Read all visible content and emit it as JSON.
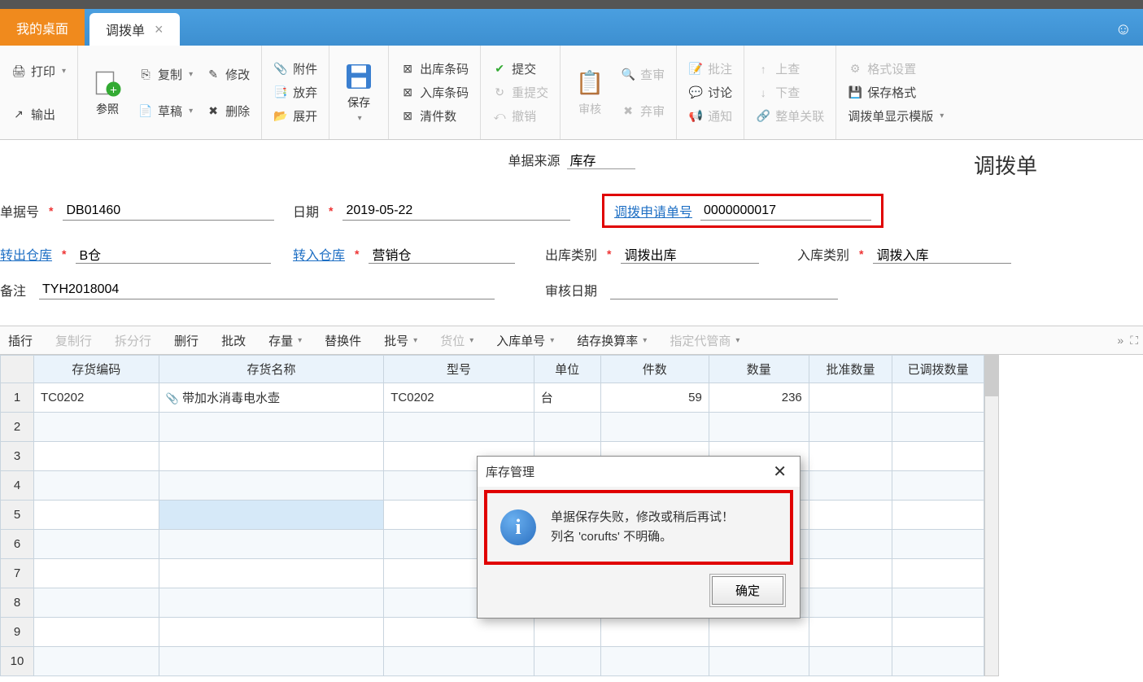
{
  "tabs": {
    "desktop": "我的桌面",
    "active": "调拨单"
  },
  "ribbon": {
    "print": "打印",
    "export": "输出",
    "ref": "参照",
    "copy": "复制",
    "draft": "草稿",
    "modify": "修改",
    "delete": "删除",
    "attach": "附件",
    "discard": "放弃",
    "expand": "展开",
    "save": "保存",
    "out_barcode": "出库条码",
    "in_barcode": "入库条码",
    "clear_count": "清件数",
    "submit": "提交",
    "resubmit": "重提交",
    "revoke": "撤销",
    "audit": "审核",
    "review": "查审",
    "abandon": "弃审",
    "note": "批注",
    "discuss": "讨论",
    "notify": "通知",
    "up": "上查",
    "down": "下查",
    "whole_link": "整单关联",
    "format_set": "格式设置",
    "save_format": "保存格式",
    "display_tpl": "调拨单显示模版"
  },
  "doc": {
    "source_label": "单据来源",
    "source_value": "库存",
    "title": "调拨单",
    "no_label": "单据号",
    "no_value": "DB01460",
    "date_label": "日期",
    "date_value": "2019-05-22",
    "req_no_label": "调拨申请单号",
    "req_no_value": "0000000017",
    "out_wh_label": "转出仓库",
    "out_wh_value": "B仓",
    "in_wh_label": "转入仓库",
    "in_wh_value": "营销仓",
    "out_type_label": "出库类别",
    "out_type_value": "调拨出库",
    "in_type_label": "入库类别",
    "in_type_value": "调拨入库",
    "remark_label": "备注",
    "remark_value": "TYH2018004",
    "audit_date_label": "审核日期",
    "audit_date_value": ""
  },
  "grid_toolbar": {
    "insert_row": "插行",
    "copy_row": "复制行",
    "split_row": "拆分行",
    "del_row": "删行",
    "batch_mod": "批改",
    "stock_qty": "存量",
    "replace": "替换件",
    "batch_no": "批号",
    "bin": "货位",
    "in_no": "入库单号",
    "conv_rate": "结存换算率",
    "agent": "指定代管商"
  },
  "grid": {
    "headers": {
      "code": "存货编码",
      "name": "存货名称",
      "model": "型号",
      "unit": "单位",
      "pieces": "件数",
      "qty": "数量",
      "approved_qty": "批准数量",
      "transferred_qty": "已调拨数量"
    },
    "rows": [
      {
        "n": "1",
        "code": "TC0202",
        "name": "带加水消毒电水壶",
        "model": "TC0202",
        "unit": "台",
        "pieces": "59",
        "qty": "236",
        "approved": "",
        "transferred": ""
      },
      {
        "n": "2"
      },
      {
        "n": "3"
      },
      {
        "n": "4"
      },
      {
        "n": "5"
      },
      {
        "n": "6"
      },
      {
        "n": "7"
      },
      {
        "n": "8"
      },
      {
        "n": "9"
      },
      {
        "n": "10"
      }
    ]
  },
  "dialog": {
    "title": "库存管理",
    "line1": "单据保存失败，修改或稍后再试！",
    "line2": "列名 'corufts' 不明确。",
    "ok": "确定"
  }
}
